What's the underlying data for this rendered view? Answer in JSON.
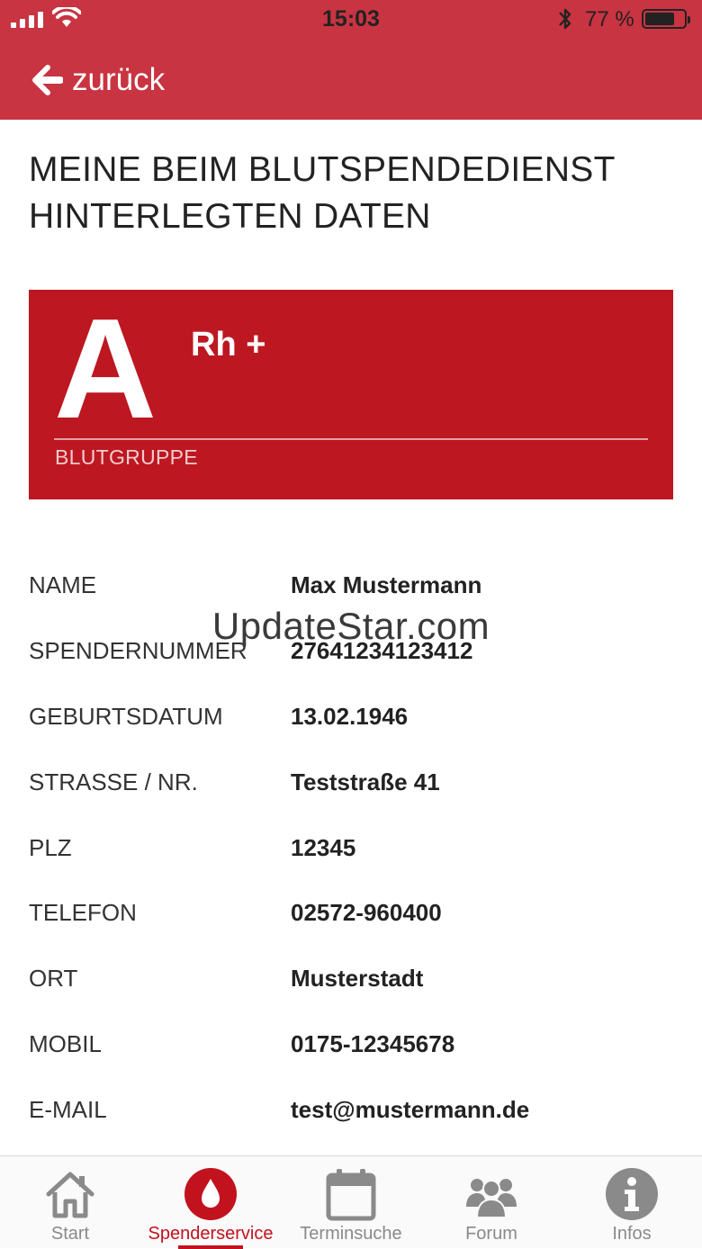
{
  "status_bar": {
    "time": "15:03",
    "battery_text": "77 %",
    "battery_level": 0.77
  },
  "nav": {
    "back_label": "zurück"
  },
  "page": {
    "title": "MEINE BEIM BLUTSPENDEDIENST HINTERLEGTEN DATEN"
  },
  "blood_group": {
    "letter": "A",
    "rhesus": "Rh +",
    "label": "BLUTGRUPPE"
  },
  "fields": [
    {
      "label": "NAME",
      "value": "Max Mustermann"
    },
    {
      "label": "SPENDERNUMMER",
      "value": "27641234123412"
    },
    {
      "label": "GEBURTSDATUM",
      "value": "13.02.1946"
    },
    {
      "label": "STRASSE / NR.",
      "value": "Teststraße 41"
    },
    {
      "label": "PLZ",
      "value": "12345"
    },
    {
      "label": "TELEFON",
      "value": "02572-960400"
    },
    {
      "label": "ORT",
      "value": "Musterstadt"
    },
    {
      "label": "MOBIL",
      "value": "0175-12345678"
    },
    {
      "label": "E-MAIL",
      "value": "test@mustermann.de"
    }
  ],
  "watermark": "UpdateStar.com",
  "tabs": [
    {
      "label": "Start",
      "icon": "home-icon"
    },
    {
      "label": "Spenderservice",
      "icon": "blood-drop-icon",
      "active": true
    },
    {
      "label": "Terminsuche",
      "icon": "calendar-icon"
    },
    {
      "label": "Forum",
      "icon": "group-icon"
    },
    {
      "label": "Infos",
      "icon": "info-icon"
    }
  ],
  "colors": {
    "header": "#c83441",
    "blood_card": "#bd1722",
    "accent": "#c2121e",
    "inactive_tab": "#8a8a8a"
  }
}
